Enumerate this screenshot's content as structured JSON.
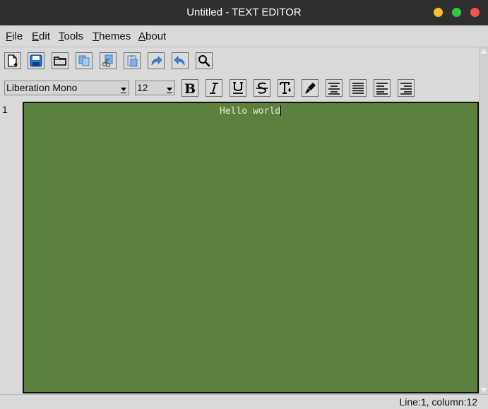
{
  "window": {
    "title": "Untitled - TEXT EDITOR"
  },
  "window_controls": {
    "minimize_color": "#f5bf2e",
    "maximize_color": "#2ec845",
    "close_color": "#f2574b"
  },
  "menu": {
    "file": {
      "accel": "F",
      "rest": "ile"
    },
    "edit": {
      "accel": "E",
      "rest": "dit"
    },
    "tools": {
      "accel": "T",
      "rest": "ools"
    },
    "themes": {
      "accel": "T",
      "rest": "hemes"
    },
    "about": {
      "accel": "A",
      "rest": "bout"
    }
  },
  "toolbar": {
    "icons": [
      "new-file-icon",
      "save-icon",
      "open-folder-icon",
      "copy-icon",
      "cut-icon",
      "paste-icon",
      "redo-icon",
      "undo-icon",
      "find-icon"
    ]
  },
  "format_bar": {
    "font_family": "Liberation Mono",
    "font_size": "12",
    "buttons": [
      "bold",
      "italic",
      "underline",
      "strikethrough",
      "font-color",
      "highlight",
      "align-center",
      "justify",
      "align-left",
      "align-right"
    ]
  },
  "editor": {
    "line_numbers": [
      "1"
    ],
    "text": "Hello world",
    "background": "#5a823d",
    "text_color": "#e3eedc"
  },
  "status": {
    "text": "Line:1, column:12"
  }
}
